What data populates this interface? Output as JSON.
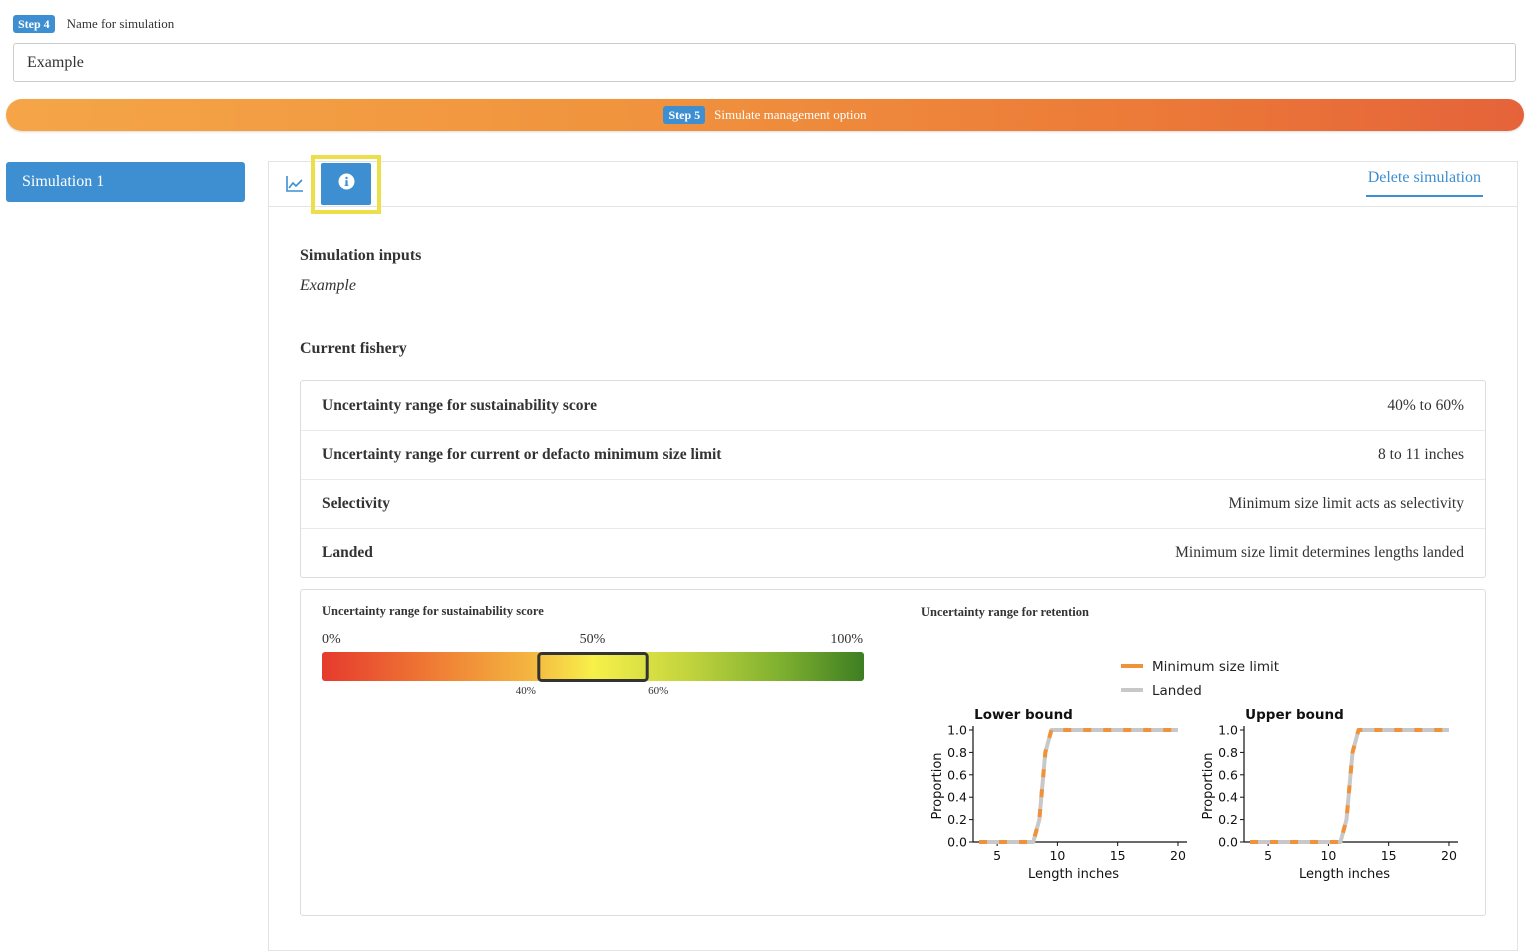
{
  "step4": {
    "badge": "Step 4",
    "label": "Name for simulation",
    "value": "Example"
  },
  "step5": {
    "badge": "Step 5",
    "label": "Simulate management option"
  },
  "sidebar": {
    "tab_label": "Simulation 1"
  },
  "tabs": {
    "chart_icon": "line-chart-icon",
    "info_icon": "info-circle-icon",
    "delete_label": "Delete simulation"
  },
  "inputs": {
    "title": "Simulation inputs",
    "name": "Example"
  },
  "fishery": {
    "title": "Current fishery",
    "rows": [
      {
        "key": "Uncertainty range for sustainability score",
        "value": "40% to 60%"
      },
      {
        "key": "Uncertainty range for current or defacto minimum size limit",
        "value": "8 to 11 inches"
      },
      {
        "key": "Selectivity",
        "value": "Minimum size limit acts as selectivity"
      },
      {
        "key": "Landed",
        "value": "Minimum size limit determines lengths landed"
      }
    ]
  },
  "score": {
    "title": "Uncertainty range for sustainability score",
    "labels": [
      "0%",
      "50%",
      "100%"
    ],
    "range_low": 40,
    "range_high": 60,
    "range_low_label": "40%",
    "range_high_label": "60%"
  },
  "retention": {
    "title": "Uncertainty range for retention",
    "legend": [
      {
        "name": "Minimum size limit",
        "color": "#f0923a"
      },
      {
        "name": "Landed",
        "color": "#c8c8c8"
      }
    ]
  },
  "colors": {
    "accent": "#3d8fd1",
    "highlight": "#ecdf4a",
    "gradient_start": "#f5a548",
    "gradient_end": "#e5633a"
  },
  "chart_data": [
    {
      "type": "line",
      "title": "Lower bound",
      "xlabel": "Length inches",
      "ylabel": "Proportion",
      "xlim": [
        3,
        20.5
      ],
      "ylim": [
        0,
        1
      ],
      "xticks": [
        "5",
        "10",
        "15",
        "20"
      ],
      "yticks": [
        "0.0",
        "0.2",
        "0.4",
        "0.6",
        "0.8",
        "1.0"
      ],
      "series": [
        {
          "name": "Minimum size limit",
          "x": [
            3.5,
            8.0,
            8.5,
            9.0,
            9.5,
            20.0
          ],
          "y": [
            0.0,
            0.0,
            0.2,
            0.8,
            1.0,
            1.0
          ]
        },
        {
          "name": "Landed",
          "x": [
            3.5,
            8.0,
            8.5,
            9.0,
            9.5,
            20.0
          ],
          "y": [
            0.0,
            0.0,
            0.2,
            0.8,
            1.0,
            1.0
          ]
        }
      ]
    },
    {
      "type": "line",
      "title": "Upper bound",
      "xlabel": "Length inches",
      "ylabel": "Proportion",
      "xlim": [
        3,
        20.5
      ],
      "ylim": [
        0,
        1
      ],
      "xticks": [
        "5",
        "10",
        "15",
        "20"
      ],
      "yticks": [
        "0.0",
        "0.2",
        "0.4",
        "0.6",
        "0.8",
        "1.0"
      ],
      "series": [
        {
          "name": "Minimum size limit",
          "x": [
            3.5,
            11.0,
            11.5,
            12.0,
            12.5,
            20.0
          ],
          "y": [
            0.0,
            0.0,
            0.2,
            0.8,
            1.0,
            1.0
          ]
        },
        {
          "name": "Landed",
          "x": [
            3.5,
            11.0,
            11.5,
            12.0,
            12.5,
            20.0
          ],
          "y": [
            0.0,
            0.0,
            0.2,
            0.8,
            1.0,
            1.0
          ]
        }
      ]
    }
  ]
}
